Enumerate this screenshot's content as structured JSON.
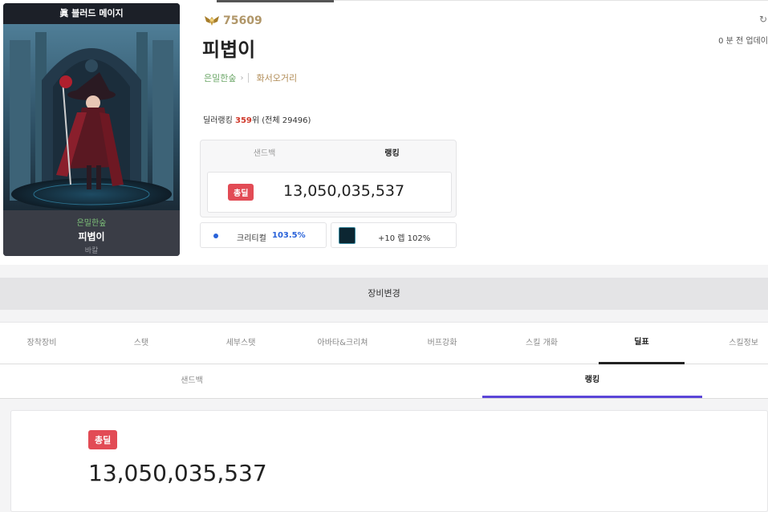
{
  "character": {
    "job_title": "眞 블러드 메이지",
    "guild": "은밀한숲",
    "name": "피볍이",
    "server": "바칼"
  },
  "profile": {
    "fame_value": "75609",
    "name": "피볍이",
    "guild_tag": "은밀한숲",
    "adventure_tag": "화서오거리",
    "updated_text": "0 분 전 업데이",
    "rank_prefix": "딜러랭킹 ",
    "rank_value": "359",
    "rank_suffix": "위 (전체 29496)"
  },
  "damage_summary": {
    "tabs": [
      "샌드백",
      "랭킹"
    ],
    "active_tab": 1,
    "badge": "총딜",
    "amount": "13,050,035,537"
  },
  "stats": {
    "crit_label": "크리티컬",
    "crit_value": "103.5%",
    "aura_value": "+10 렙 102%"
  },
  "equip_change_label": "장비변경",
  "main_nav": {
    "items": [
      "장착장비",
      "스탯",
      "세부스탯",
      "아바타&크리쳐",
      "버프강화",
      "스킬 개화",
      "딜표",
      "스킬정보"
    ],
    "active": 6
  },
  "sub_nav": {
    "items": [
      "샌드백",
      "랭킹"
    ],
    "active": 1
  },
  "big_damage": {
    "badge": "총딜",
    "amount": "13,050,035,537"
  },
  "colors": {
    "accent_purple": "#5b46d8",
    "badge_red": "#e24b55",
    "rank_red": "#d0392b",
    "crit_blue": "#2962d9",
    "guild_green": "#6ea86a",
    "fame_gold": "#b09668"
  }
}
